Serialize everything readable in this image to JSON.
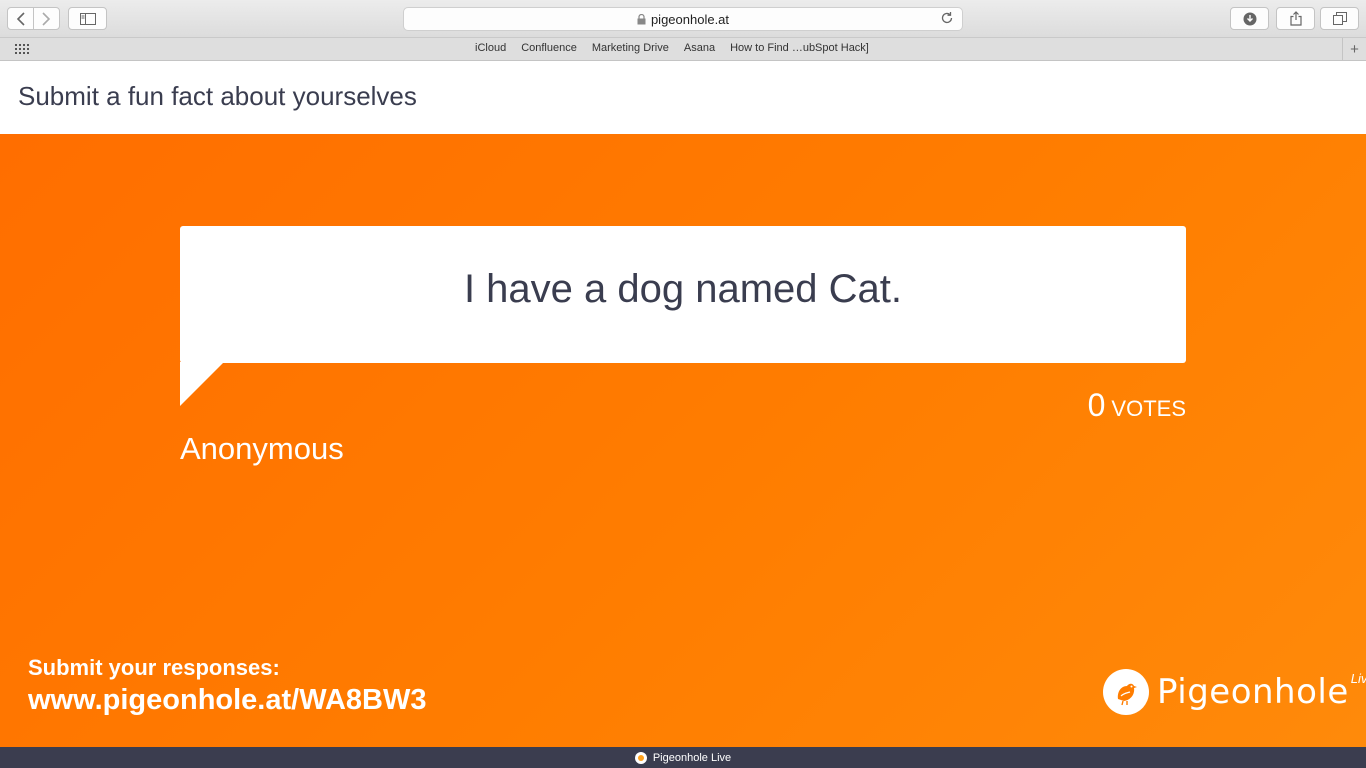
{
  "browser": {
    "url": "pigeonhole.at",
    "bookmarks": [
      "iCloud",
      "Confluence",
      "Marketing Drive",
      "Asana",
      "How to Find …ubSpot Hack]"
    ]
  },
  "page": {
    "title": "Submit a fun fact about yourselves"
  },
  "question": {
    "text": "I have a dog named Cat.",
    "votes_count": "0",
    "votes_label": "VOTES",
    "author": "Anonymous"
  },
  "footer": {
    "submit_label": "Submit your responses:",
    "submit_url": "www.pigeonhole.at/WA8BW3",
    "logo_word": "Pigeonhole",
    "logo_live": "Live"
  },
  "bottom_bar": {
    "label": "Pigeonhole Live"
  },
  "colors": {
    "accent": "#ff7a00",
    "text_dark": "#3a3d4f",
    "bottom_bar": "#3b3d4f"
  }
}
